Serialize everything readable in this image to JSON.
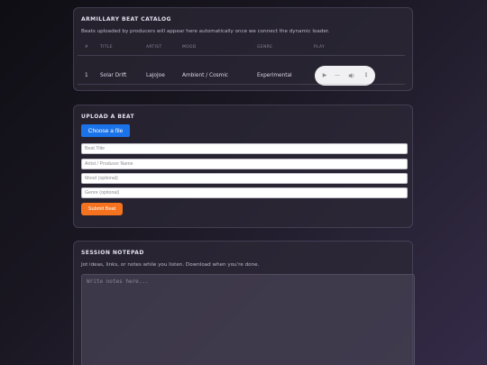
{
  "catalog": {
    "title": "ARMILLARY BEAT CATALOG",
    "description": "Beats uploaded by producers will appear here automatically once we connect the dynamic loader.",
    "columns": [
      "#",
      "TITLE",
      "ARTIST",
      "MOOD",
      "GENRE",
      "PLAY"
    ],
    "rows": [
      {
        "num": "1",
        "title": "Solar Drift",
        "artist": "LajoJoe",
        "mood": "Ambient / Cosmic",
        "genre": "Experimental"
      }
    ],
    "player": {
      "play_icon": "play-icon",
      "volume_icon": "volume-icon",
      "more_icon": "more-vertical-icon"
    }
  },
  "upload": {
    "title": "UPLOAD A BEAT",
    "choose_label": "Choose a file",
    "fields": {
      "title_placeholder": "Beat Title",
      "artist_placeholder": "Artist / Producer Name",
      "mood_placeholder": "Mood (optional)",
      "genre_placeholder": "Genre (optional)"
    },
    "submit_label": "Submit Beat"
  },
  "notepad": {
    "title": "SESSION NOTEPAD",
    "description": "Jot ideas, links, or notes while you listen. Download when you're done.",
    "placeholder": "Write notes here..."
  },
  "colors": {
    "choose_button": "#1a73e8",
    "submit_button": "#f5731f"
  }
}
